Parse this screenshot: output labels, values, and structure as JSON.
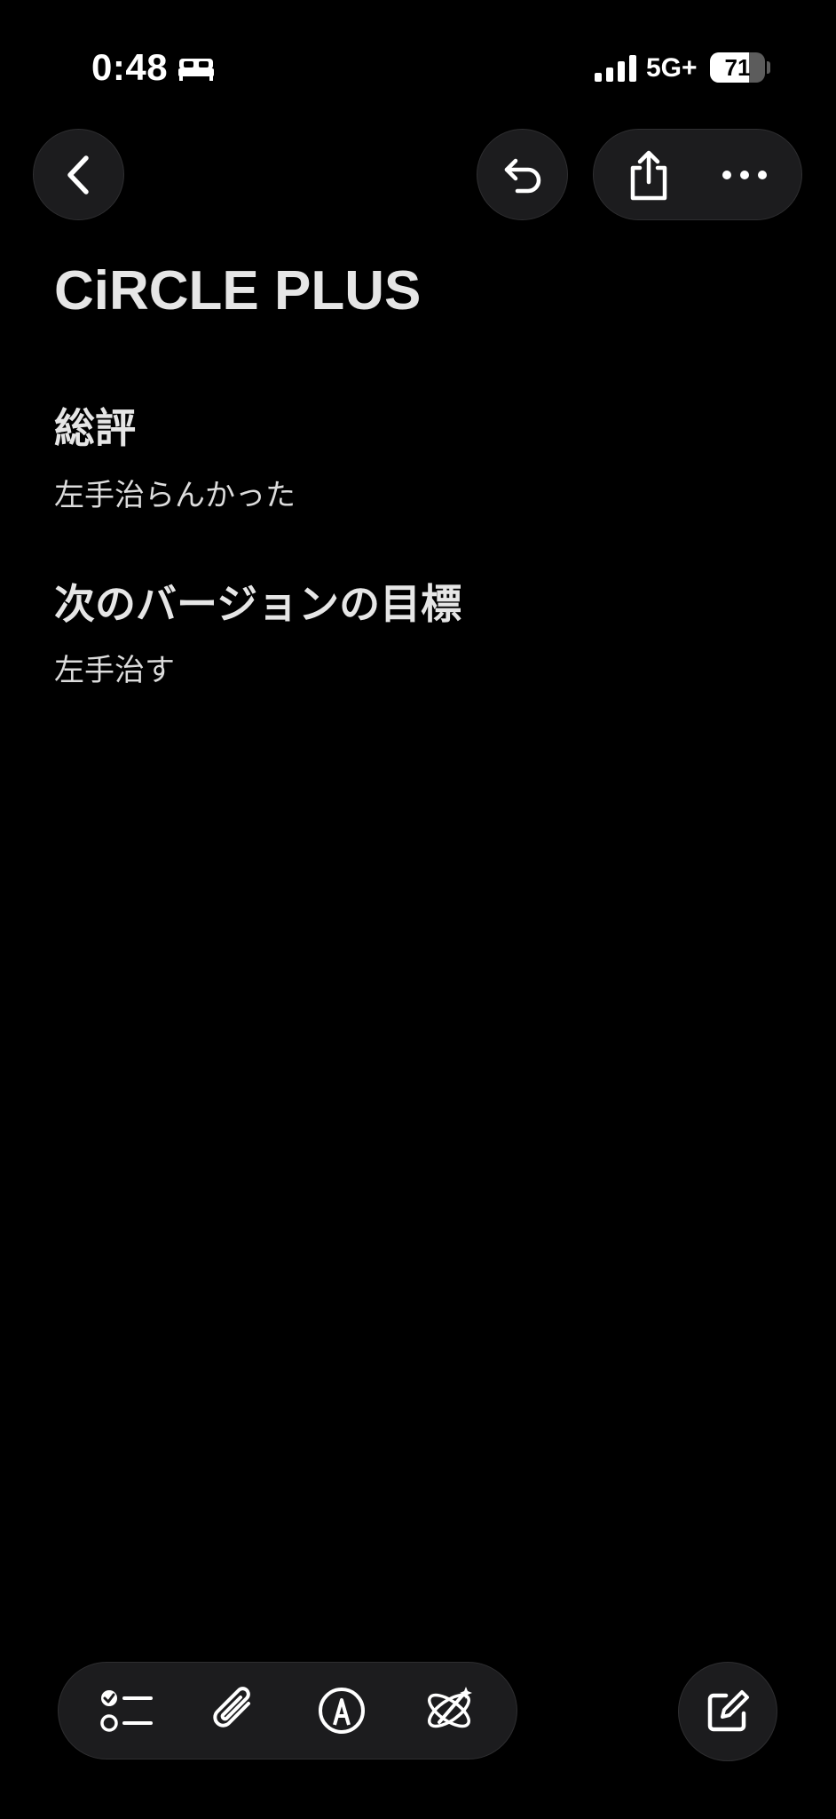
{
  "status_bar": {
    "time": "0:48",
    "network": "5G+",
    "battery_level": 71,
    "battery_text": "71",
    "icons": [
      "bed-icon",
      "signal-icon",
      "battery-icon"
    ]
  },
  "nav": {
    "icons": [
      "chevron-left-icon",
      "undo-icon",
      "share-icon",
      "ellipsis-icon"
    ]
  },
  "note": {
    "title": "CiRCLE PLUS",
    "sections": [
      {
        "heading": "総評",
        "body": "左手治らんかった"
      },
      {
        "heading": "次のバージョンの目標",
        "body": "左手治す"
      }
    ]
  },
  "toolbar": {
    "icons": [
      "checklist-icon",
      "paperclip-icon",
      "markup-pen-icon",
      "writing-tools-icon",
      "compose-icon"
    ]
  },
  "colors": {
    "background": "#000000",
    "button_fill": "#1c1c1e",
    "text": "#e6e6e6"
  }
}
